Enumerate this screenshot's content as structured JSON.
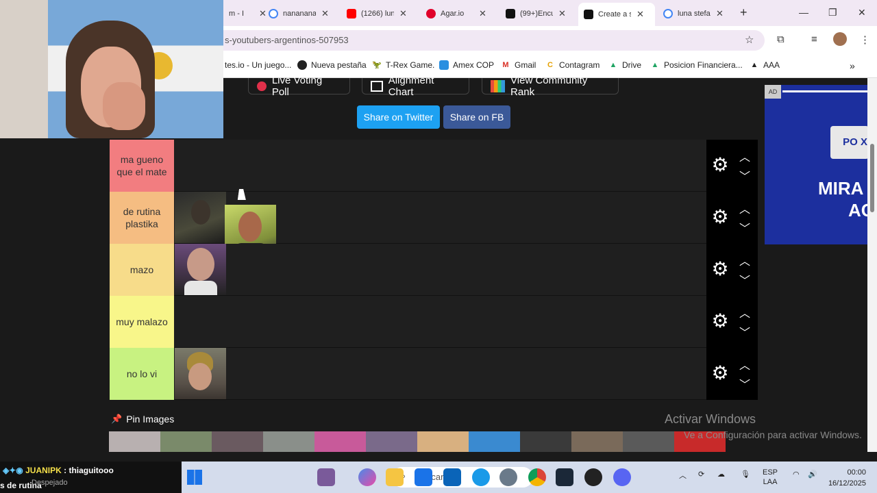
{
  "browser": {
    "tabs": [
      {
        "label": "m - I",
        "color": "#9b59b6"
      },
      {
        "label": "nananana",
        "color": "#4285f4"
      },
      {
        "label": "(1266) lun",
        "color": "#ff0000"
      },
      {
        "label": "Agar.io",
        "color": "#e0002a"
      },
      {
        "label": "(99+)Encu",
        "color": "#111111"
      },
      {
        "label": "Create a s",
        "color": "#111111"
      },
      {
        "label": "luna stefa",
        "color": "#4285f4"
      }
    ],
    "new_tab": "+",
    "url": "s-youtubers-argentinos-507953",
    "bookmarks": [
      {
        "label": "tes.io - Un juego...",
        "icon": "page-icon"
      },
      {
        "label": "Nueva pestaña",
        "icon": "globe-icon"
      },
      {
        "label": "T-Rex Game.",
        "icon": "dino-icon"
      },
      {
        "label": "Amex COP",
        "icon": "amex-icon"
      },
      {
        "label": "Gmail",
        "icon": "gmail-icon"
      },
      {
        "label": "Contagram",
        "icon": "contagram-icon"
      },
      {
        "label": "Drive",
        "icon": "drive-icon"
      },
      {
        "label": "Posicion Financiera...",
        "icon": "drive-icon"
      },
      {
        "label": "AAA",
        "icon": "aaa-icon"
      }
    ]
  },
  "page": {
    "top_buttons": [
      "Live Voting Poll",
      "Alignment Chart",
      "View Community Rank"
    ],
    "share_twitter": "Share on Twitter",
    "share_fb": "Share on FB",
    "tiers": [
      {
        "label": "ma gueno que el mate",
        "color": "#f27d80",
        "items": []
      },
      {
        "label": "de rutina plastika",
        "color": "#f5bd82",
        "items": [
          "portrait-1",
          "portrait-2"
        ]
      },
      {
        "label": "mazo",
        "color": "#f7dc8a",
        "items": [
          "portrait-3"
        ]
      },
      {
        "label": "muy malazo",
        "color": "#f8f68a",
        "items": []
      },
      {
        "label": "no lo vi",
        "color": "#c8f281",
        "items": [
          "portrait-4"
        ]
      }
    ],
    "pin_images_label": "Pin Images",
    "ad_tag": "AD",
    "ad_text_1": "MIRA",
    "ad_text_2": "AC",
    "ad_product": "PO X"
  },
  "windows_watermark": {
    "title": "Activar Windows",
    "subtitle": "Ve a Configuración para activar Windows."
  },
  "stream_overlay": {
    "chat_user": "JUANIPK",
    "chat_message": ": thiaguitooo",
    "ticker": "s de rutina",
    "weather": "Despejado"
  },
  "taskbar": {
    "search_placeholder": "Buscar",
    "language": "ESP",
    "layout": "LAA",
    "time": "00:00",
    "date": "16/12/2025"
  }
}
